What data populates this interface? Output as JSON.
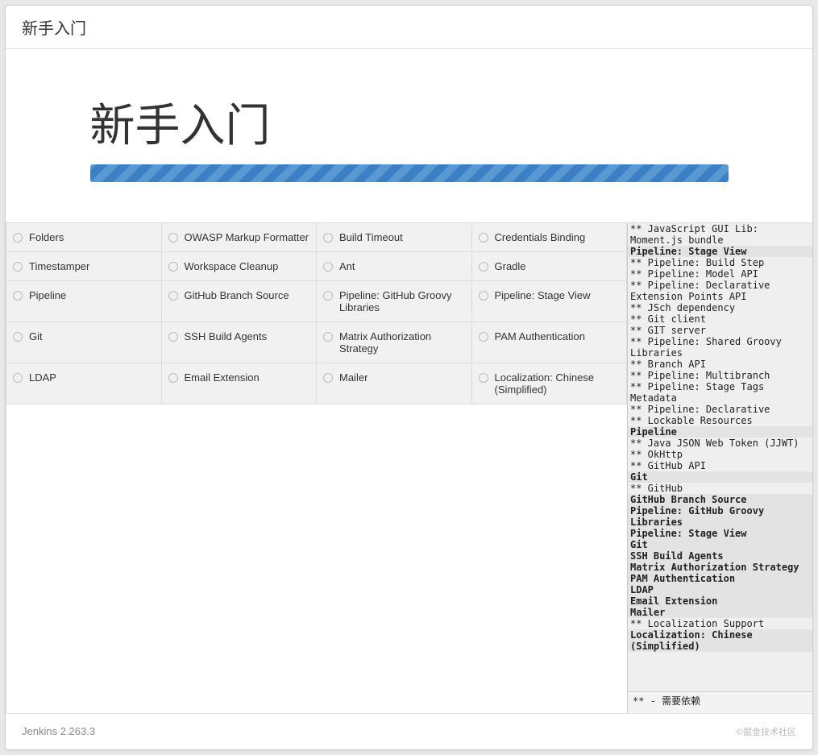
{
  "window_title": "新手入门",
  "hero_title": "新手入门",
  "plugins": [
    "Folders",
    "OWASP Markup Formatter",
    "Build Timeout",
    "Credentials Binding",
    "Timestamper",
    "Workspace Cleanup",
    "Ant",
    "Gradle",
    "Pipeline",
    "GitHub Branch Source",
    "Pipeline: GitHub Groovy Libraries",
    "Pipeline: Stage View",
    "Git",
    "SSH Build Agents",
    "Matrix Authorization Strategy",
    "PAM Authentication",
    "LDAP",
    "Email Extension",
    "Mailer",
    "Localization: Chinese (Simplified)"
  ],
  "log": [
    {
      "text": "** JavaScript GUI Lib: Moment.js bundle"
    },
    {
      "text": "Pipeline: Stage View",
      "b": true,
      "bg": true
    },
    {
      "text": "** Pipeline: Build Step"
    },
    {
      "text": "** Pipeline: Model API"
    },
    {
      "text": "** Pipeline: Declarative Extension Points API"
    },
    {
      "text": "** JSch dependency"
    },
    {
      "text": "** Git client"
    },
    {
      "text": "** GIT server"
    },
    {
      "text": "** Pipeline: Shared Groovy Libraries"
    },
    {
      "text": "** Branch API"
    },
    {
      "text": "** Pipeline: Multibranch"
    },
    {
      "text": "** Pipeline: Stage Tags Metadata"
    },
    {
      "text": "** Pipeline: Declarative"
    },
    {
      "text": "** Lockable Resources"
    },
    {
      "text": "Pipeline",
      "b": true,
      "bg": true
    },
    {
      "text": "** Java JSON Web Token (JJWT)"
    },
    {
      "text": "** OkHttp"
    },
    {
      "text": "** GitHub API"
    },
    {
      "text": "Git",
      "b": true,
      "bg": true
    },
    {
      "text": "** GitHub"
    },
    {
      "text": "GitHub Branch Source",
      "b": true,
      "bg": true
    },
    {
      "text": "Pipeline: GitHub Groovy Libraries",
      "b": true,
      "bg": true
    },
    {
      "text": "Pipeline: Stage View",
      "b": true,
      "bg": true
    },
    {
      "text": "Git",
      "b": true,
      "bg": true
    },
    {
      "text": "SSH Build Agents",
      "b": true,
      "bg": true
    },
    {
      "text": "Matrix Authorization Strategy",
      "b": true,
      "bg": true
    },
    {
      "text": "PAM Authentication",
      "b": true,
      "bg": true
    },
    {
      "text": "LDAP",
      "b": true,
      "bg": true
    },
    {
      "text": "Email Extension",
      "b": true,
      "bg": true
    },
    {
      "text": "Mailer",
      "b": true,
      "bg": true
    },
    {
      "text": "** Localization Support"
    },
    {
      "text": "Localization: Chinese (Simplified)",
      "b": true,
      "bg": true
    }
  ],
  "log_footer": "** - 需要依赖",
  "footer_version": "Jenkins 2.263.3",
  "watermark": "©掘金技术社区"
}
